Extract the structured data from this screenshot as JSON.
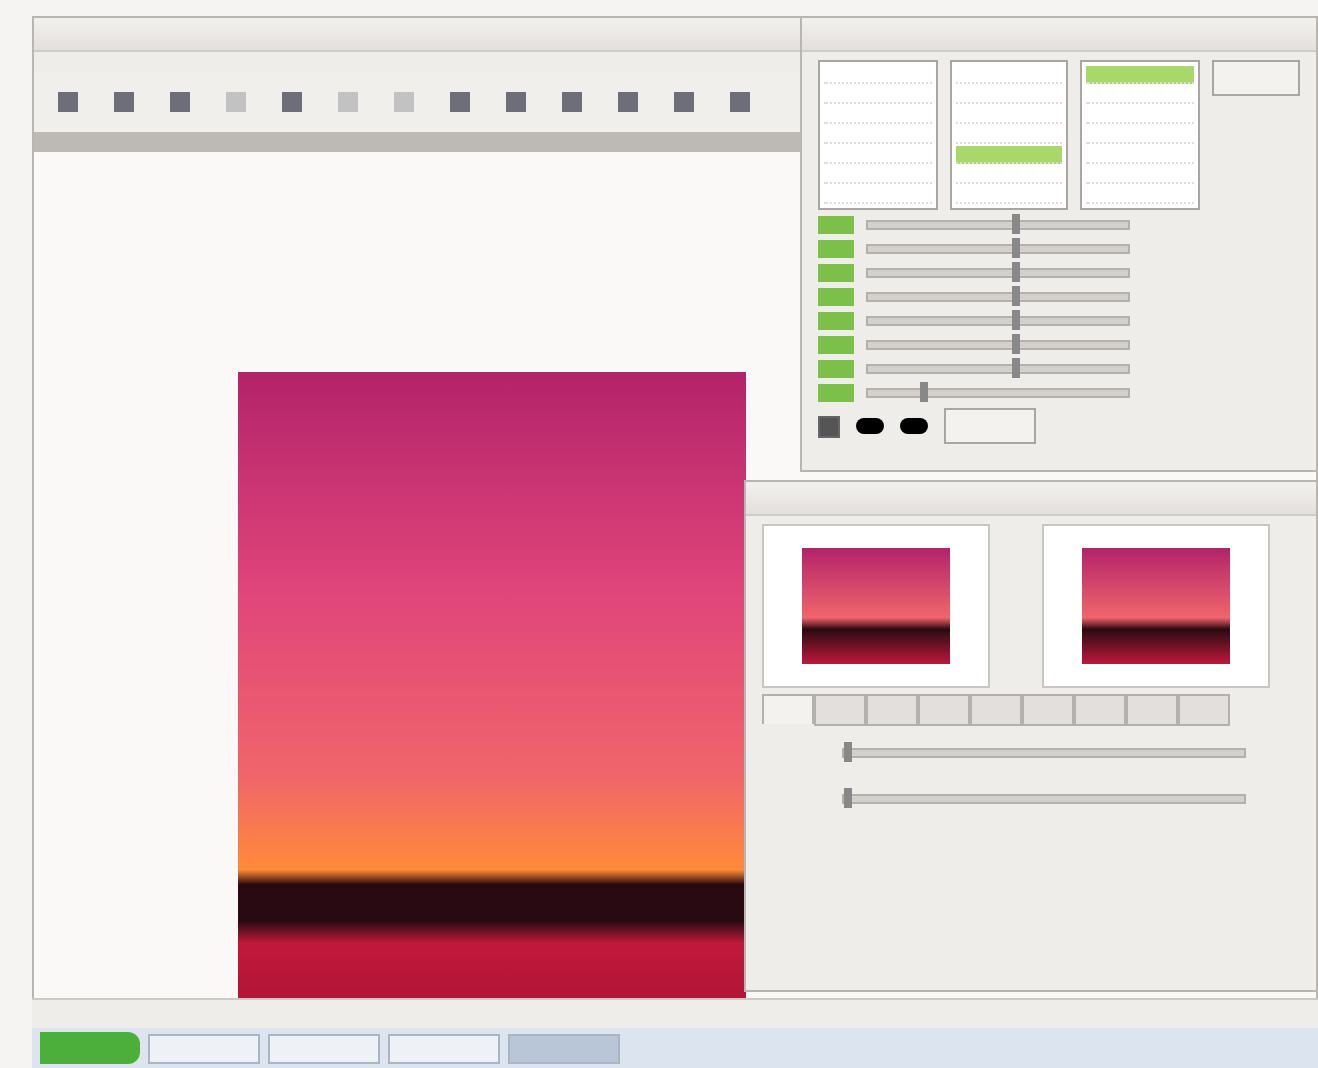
{
  "editor": {
    "toolbar": {
      "buttons": [
        {
          "disabled": false
        },
        {
          "disabled": false
        },
        {
          "disabled": false
        },
        {
          "disabled": true
        },
        {
          "disabled": false
        },
        {
          "disabled": true
        },
        {
          "disabled": true
        },
        {
          "disabled": false
        },
        {
          "disabled": false
        },
        {
          "disabled": false
        },
        {
          "disabled": false
        },
        {
          "disabled": false
        },
        {
          "disabled": false
        }
      ]
    }
  },
  "adjust_dialog": {
    "lists": [
      {
        "rows": [
          {
            "selected": false
          },
          {
            "selected": false
          },
          {
            "selected": false
          },
          {
            "selected": false
          },
          {
            "selected": false
          },
          {
            "selected": false
          },
          {
            "selected": false
          }
        ]
      },
      {
        "rows": [
          {
            "selected": false
          },
          {
            "selected": false
          },
          {
            "selected": false
          },
          {
            "selected": false
          },
          {
            "selected": true
          },
          {
            "selected": false
          },
          {
            "selected": false
          }
        ]
      },
      {
        "rows": [
          {
            "selected": true
          },
          {
            "selected": false
          },
          {
            "selected": false
          },
          {
            "selected": false
          },
          {
            "selected": false
          },
          {
            "selected": false
          },
          {
            "selected": false
          }
        ]
      }
    ],
    "channels": [
      {
        "level": 0.55
      },
      {
        "level": 0.55
      },
      {
        "level": 0.55
      },
      {
        "level": 0.55
      },
      {
        "level": 0.55
      },
      {
        "level": 0.55
      },
      {
        "level": 0.55
      },
      {
        "level": 0.2
      }
    ],
    "checkbox": {
      "checked": true
    },
    "swatches": [
      {
        "color": "#000000"
      },
      {
        "color": "#000000"
      }
    ]
  },
  "preview_dialog": {
    "tabs": [
      {
        "selected": true
      },
      {
        "selected": false
      },
      {
        "selected": false
      },
      {
        "selected": false
      },
      {
        "selected": false
      },
      {
        "selected": false
      },
      {
        "selected": false
      },
      {
        "selected": false
      },
      {
        "selected": false
      }
    ],
    "sliders": [
      {
        "level": 0.0
      },
      {
        "level": 0.0
      }
    ]
  },
  "taskbar": {
    "windows": [
      {
        "selected": false
      },
      {
        "selected": false
      },
      {
        "selected": false
      },
      {
        "selected": true
      }
    ]
  }
}
